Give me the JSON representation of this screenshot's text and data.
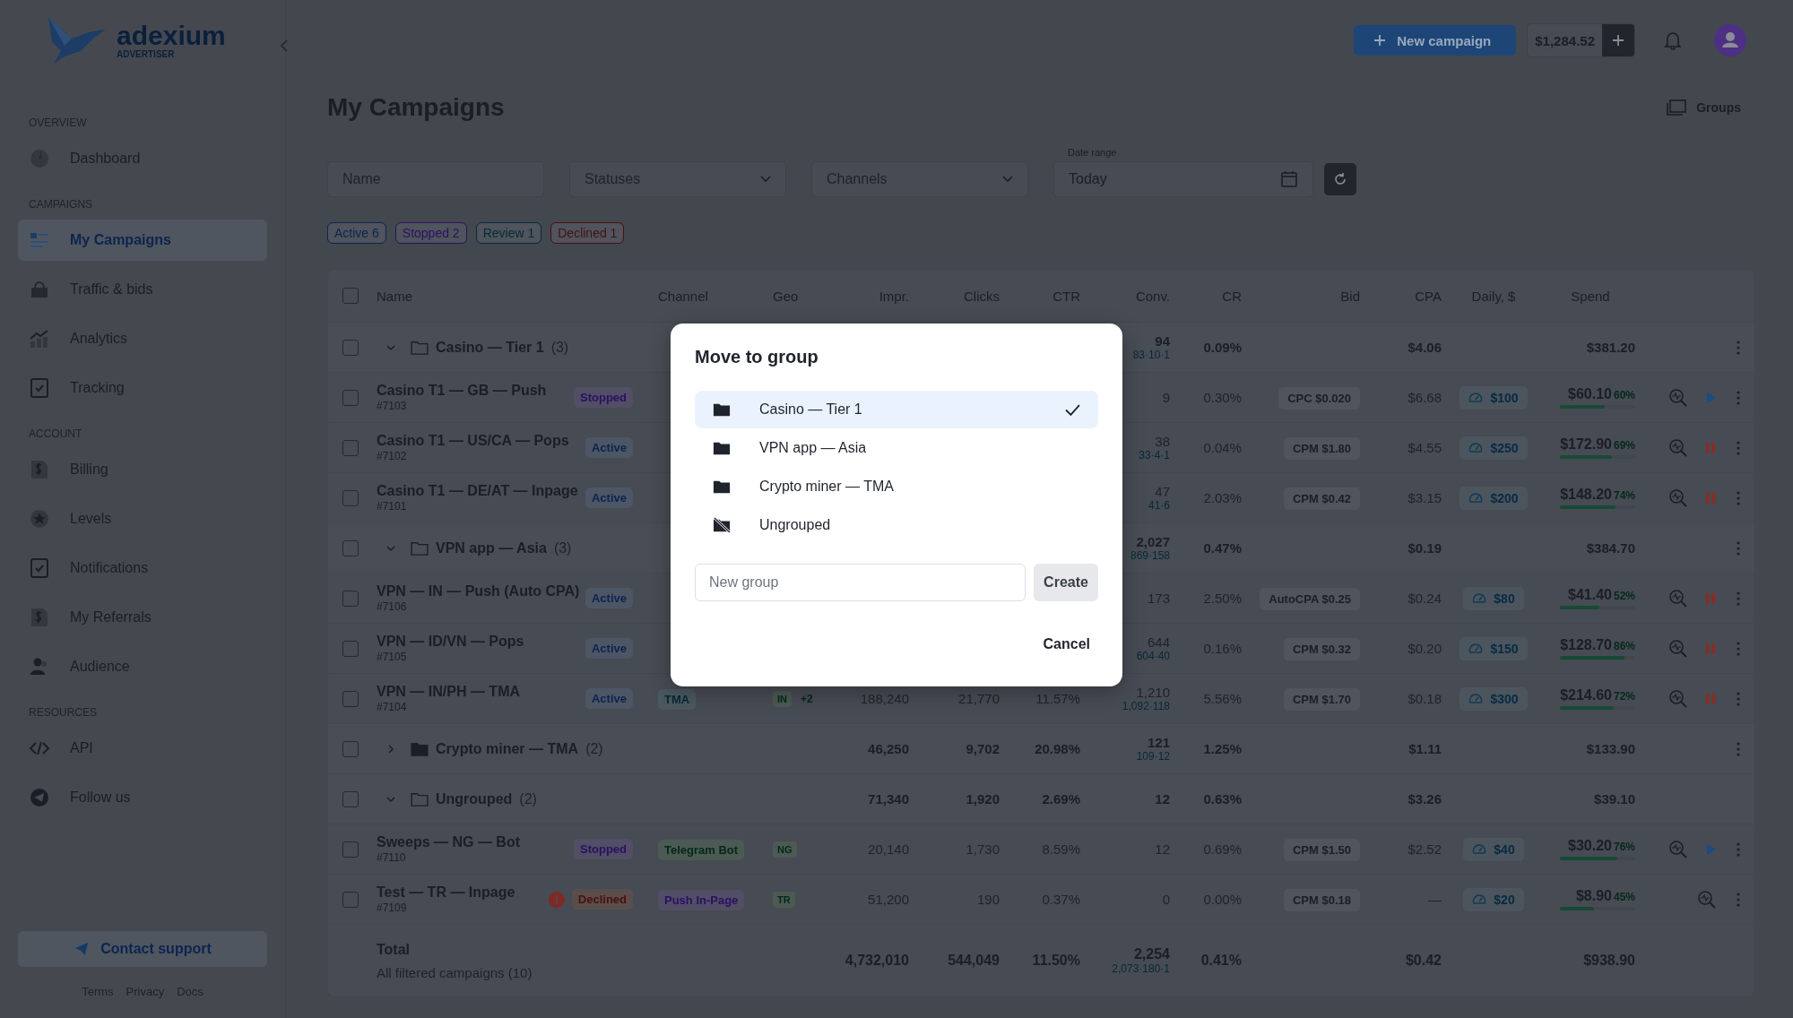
{
  "sidebar": {
    "logo": {
      "name": "adexium",
      "tagline": "ADVERTISER"
    },
    "sections": [
      {
        "title": "OVERVIEW",
        "items": [
          {
            "label": "Dashboard",
            "selected": false
          }
        ]
      },
      {
        "title": "CAMPAIGNS",
        "items": [
          {
            "label": "My Campaigns",
            "selected": true
          },
          {
            "label": "Traffic & bids",
            "selected": false
          },
          {
            "label": "Analytics",
            "selected": false
          },
          {
            "label": "Tracking",
            "selected": false
          }
        ]
      },
      {
        "title": "ACCOUNT",
        "items": [
          {
            "label": "Billing",
            "selected": false
          },
          {
            "label": "Levels",
            "selected": false
          },
          {
            "label": "Notifications",
            "selected": false
          },
          {
            "label": "My Referrals",
            "selected": false
          },
          {
            "label": "Audience",
            "selected": false
          }
        ]
      },
      {
        "title": "RESOURCES",
        "items": [
          {
            "label": "API",
            "selected": false
          },
          {
            "label": "Follow us",
            "selected": false
          }
        ]
      }
    ],
    "support_button": "Contact support",
    "footer_links": [
      "Terms",
      "Privacy",
      "Docs"
    ]
  },
  "header": {
    "new_campaign": "New campaign",
    "balance": "$1,284.52"
  },
  "page": {
    "title": "My Campaigns",
    "groups_button": "Groups"
  },
  "filters": {
    "name_placeholder": "Name",
    "statuses_placeholder": "Statuses",
    "channels_placeholder": "Channels",
    "date_label": "Date range",
    "date_value": "Today"
  },
  "status_chips": [
    {
      "label": "Active 6",
      "color": "#0c2450"
    },
    {
      "label": "Stopped 2",
      "color": "#2a1160"
    },
    {
      "label": "Review 1",
      "color": "#052a36"
    },
    {
      "label": "Declined 1",
      "color": "#4a100c"
    }
  ],
  "table": {
    "select_all_checked": false,
    "columns": [
      "Name",
      "Channel",
      "Geo",
      "Impr.",
      "Clicks",
      "CTR",
      "Conv.",
      "CR",
      "Bid",
      "CPA",
      "Daily, $",
      "Spend"
    ],
    "groups": [
      {
        "name": "Casino — Tier 1",
        "count": "(3)",
        "checked": false,
        "expanded": true,
        "menu": true,
        "conv": "94",
        "conv_split": "83·10·1",
        "cr": "0.09%",
        "cpa": "$4.06",
        "spend": "$381.20",
        "campaigns": [
          {
            "name": "Casino T1 — GB — Push",
            "id": "#7103",
            "checked": false,
            "status": {
              "label": "Stopped",
              "kind": "stopped"
            },
            "conv": "9",
            "cr": "0.30%",
            "bid": "CPC $0.020",
            "cpa": "$6.68",
            "daily": "$100",
            "spend": "$60.10",
            "spend_pct": "60%",
            "level": 0.6,
            "action": {
              "kind": "play"
            }
          },
          {
            "name": "Casino T1 — US/CA — Pops",
            "id": "#7102",
            "checked": false,
            "status": {
              "label": "Active",
              "kind": "active"
            },
            "conv": "38",
            "conv_split": "33·4·1",
            "cr": "0.04%",
            "bid": "CPM $1.80",
            "cpa": "$4.55",
            "daily": "$250",
            "spend": "$172.90",
            "spend_pct": "69%",
            "level": 0.69,
            "action": {
              "kind": "pause"
            }
          },
          {
            "name": "Casino T1 — DE/AT — Inpage",
            "id": "#7101",
            "checked": false,
            "status": {
              "label": "Active",
              "kind": "active"
            },
            "conv": "47",
            "conv_split": "41·6",
            "cr": "2.03%",
            "bid": "CPM $0.42",
            "cpa": "$3.15",
            "daily": "$200",
            "spend": "$148.20",
            "spend_pct": "74%",
            "level": 0.74,
            "action": {
              "kind": "pause"
            }
          }
        ]
      },
      {
        "name": "VPN app — Asia",
        "count": "(3)",
        "checked": false,
        "expanded": true,
        "menu": true,
        "conv": "2,027",
        "conv_split": "869·158",
        "cr": "0.47%",
        "cpa": "$0.19",
        "spend": "$384.70",
        "campaigns": [
          {
            "name": "VPN — IN — Push (Auto CPA)",
            "id": "#7106",
            "checked": false,
            "status": {
              "label": "Active",
              "kind": "active"
            },
            "conv": "173",
            "cr": "2.50%",
            "bid": "AutoCPA $0.25",
            "cpa": "$0.24",
            "daily": "$80",
            "spend": "$41.40",
            "spend_pct": "52%",
            "level": 0.52,
            "action": {
              "kind": "pause"
            }
          },
          {
            "name": "VPN — ID/VN — Pops",
            "id": "#7105",
            "checked": false,
            "status": {
              "label": "Active",
              "kind": "active"
            },
            "conv": "644",
            "conv_split": "604·40",
            "cr": "0.16%",
            "bid": "CPM $0.32",
            "cpa": "$0.20",
            "daily": "$150",
            "spend": "$128.70",
            "spend_pct": "86%",
            "level": 0.86,
            "action": {
              "kind": "pause"
            }
          },
          {
            "name": "VPN — IN/PH — TMA",
            "id": "#7104",
            "checked": false,
            "status": {
              "label": "Active",
              "kind": "active"
            },
            "channel": {
              "label": "TMA",
              "kind": "tma"
            },
            "geo": [
              "IN",
              "+2"
            ],
            "impr": "188,240",
            "clicks": "21,770",
            "ctr": "11.57%",
            "conv": "1,210",
            "conv_split": "1,092·118",
            "cr": "5.56%",
            "bid": "CPM $1.70",
            "cpa": "$0.18",
            "daily": "$300",
            "spend": "$214.60",
            "spend_pct": "72%",
            "level": 0.72,
            "action": {
              "kind": "pause"
            }
          }
        ]
      },
      {
        "name": "Crypto miner — TMA",
        "count": "(2)",
        "checked": false,
        "expanded": false,
        "menu": true,
        "impr": "46,250",
        "clicks": "9,702",
        "ctr": "20.98%",
        "conv": "121",
        "conv_split": "109·12",
        "cr": "1.25%",
        "cpa": "$1.11",
        "spend": "$133.90"
      },
      {
        "name": "Ungrouped",
        "count": "(2)",
        "checked": false,
        "expanded": true,
        "menu": false,
        "impr": "71,340",
        "clicks": "1,920",
        "ctr": "2.69%",
        "conv": "12",
        "cr": "0.63%",
        "cpa": "$3.26",
        "spend": "$39.10",
        "campaigns": [
          {
            "name": "Sweeps — NG — Bot",
            "id": "#7110",
            "checked": false,
            "status": {
              "label": "Stopped",
              "kind": "stopped"
            },
            "channel": {
              "label": "Telegram Bot",
              "kind": "telegram"
            },
            "geo": [
              "NG"
            ],
            "impr": "20,140",
            "clicks": "1,730",
            "ctr": "8.59%",
            "conv": "12",
            "cr": "0.69%",
            "bid": "CPM $1.50",
            "cpa": "$2.52",
            "daily": "$40",
            "spend": "$30.20",
            "spend_pct": "76%",
            "level": 0.76,
            "action": {
              "kind": "play"
            }
          },
          {
            "name": "Test — TR — Inpage",
            "id": "#7109",
            "checked": false,
            "status": {
              "label": "Declined",
              "kind": "declined"
            },
            "channel": {
              "label": "Push In-Page",
              "kind": "push"
            },
            "geo": [
              "TR"
            ],
            "impr": "51,200",
            "clicks": "190",
            "ctr": "0.37%",
            "conv": "0",
            "cr": "0.00%",
            "bid": "CPM $0.18",
            "cpa": "—",
            "daily": "$20",
            "spend": "$8.90",
            "spend_pct": "45%",
            "level": 0.45
          }
        ]
      }
    ],
    "total": {
      "label": "Total",
      "sublabel": "All filtered campaigns (10)",
      "impr": "4,732,010",
      "clicks": "544,049",
      "ctr": "11.50%",
      "conv": "2,254",
      "conv_split": "2,073·180·1",
      "cr": "0.41%",
      "cpa": "$0.42",
      "spend": "$938.90"
    }
  },
  "modal": {
    "title": "Move to group",
    "options": [
      {
        "label": "Casino — Tier 1",
        "kind": "folder",
        "selected": true
      },
      {
        "label": "VPN app — Asia",
        "kind": "folder",
        "selected": false
      },
      {
        "label": "Crypto miner — TMA",
        "kind": "folder",
        "selected": false
      },
      {
        "label": "Ungrouped",
        "kind": "none",
        "selected": false
      }
    ],
    "new_group_placeholder": "New group",
    "create_button": "Create",
    "cancel_button": "Cancel"
  }
}
